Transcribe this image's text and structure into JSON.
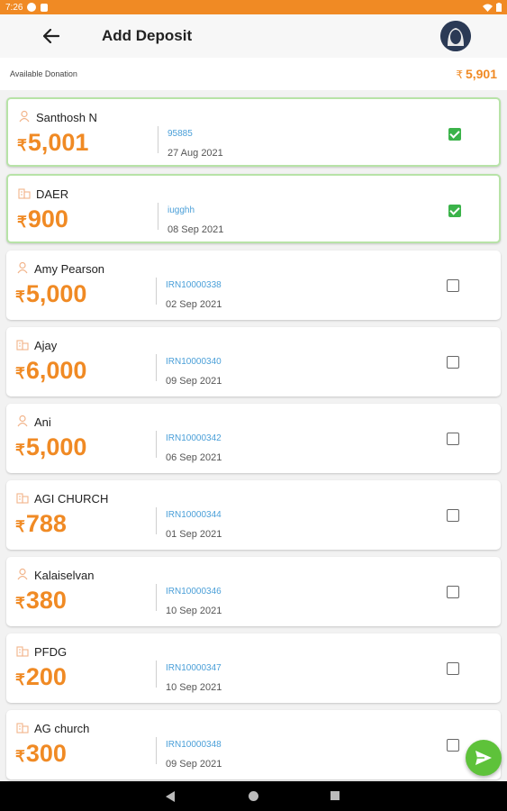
{
  "status_bar": {
    "time": "7:26"
  },
  "header": {
    "title": "Add Deposit"
  },
  "summary": {
    "label": "Available Donation",
    "currency": "₹",
    "value": "5,901"
  },
  "currency_symbol": "₹",
  "deposits": [
    {
      "name": "Santhosh N",
      "amount": "5,001",
      "ref": "95885",
      "date": "27 Aug 2021",
      "checked": true,
      "type": "person"
    },
    {
      "name": "DAER",
      "amount": "900",
      "ref": "iugghh",
      "date": "08 Sep 2021",
      "checked": true,
      "type": "organization"
    },
    {
      "name": "Amy Pearson",
      "amount": "5,000",
      "ref": "IRN10000338",
      "date": "02 Sep 2021",
      "checked": false,
      "type": "person"
    },
    {
      "name": "Ajay",
      "amount": "6,000",
      "ref": "IRN10000340",
      "date": "09 Sep 2021",
      "checked": false,
      "type": "organization"
    },
    {
      "name": "Ani",
      "amount": "5,000",
      "ref": "IRN10000342",
      "date": "06 Sep 2021",
      "checked": false,
      "type": "person"
    },
    {
      "name": "AGI CHURCH",
      "amount": "788",
      "ref": "IRN10000344",
      "date": "01 Sep 2021",
      "checked": false,
      "type": "organization"
    },
    {
      "name": "Kalaiselvan",
      "amount": "380",
      "ref": "IRN10000346",
      "date": "10 Sep 2021",
      "checked": false,
      "type": "person"
    },
    {
      "name": "PFDG",
      "amount": "200",
      "ref": "IRN10000347",
      "date": "10 Sep 2021",
      "checked": false,
      "type": "organization"
    },
    {
      "name": "AG church",
      "amount": "300",
      "ref": "IRN10000348",
      "date": "09 Sep 2021",
      "checked": false,
      "type": "organization"
    }
  ],
  "colors": {
    "accent": "#f08a24",
    "link": "#4a9fd8",
    "success": "#3bb34a",
    "selected_border": "#b7e3a7"
  },
  "icons": {
    "back": "arrow-left-icon",
    "person": "person-icon",
    "organization": "building-icon",
    "submit": "send-icon"
  }
}
